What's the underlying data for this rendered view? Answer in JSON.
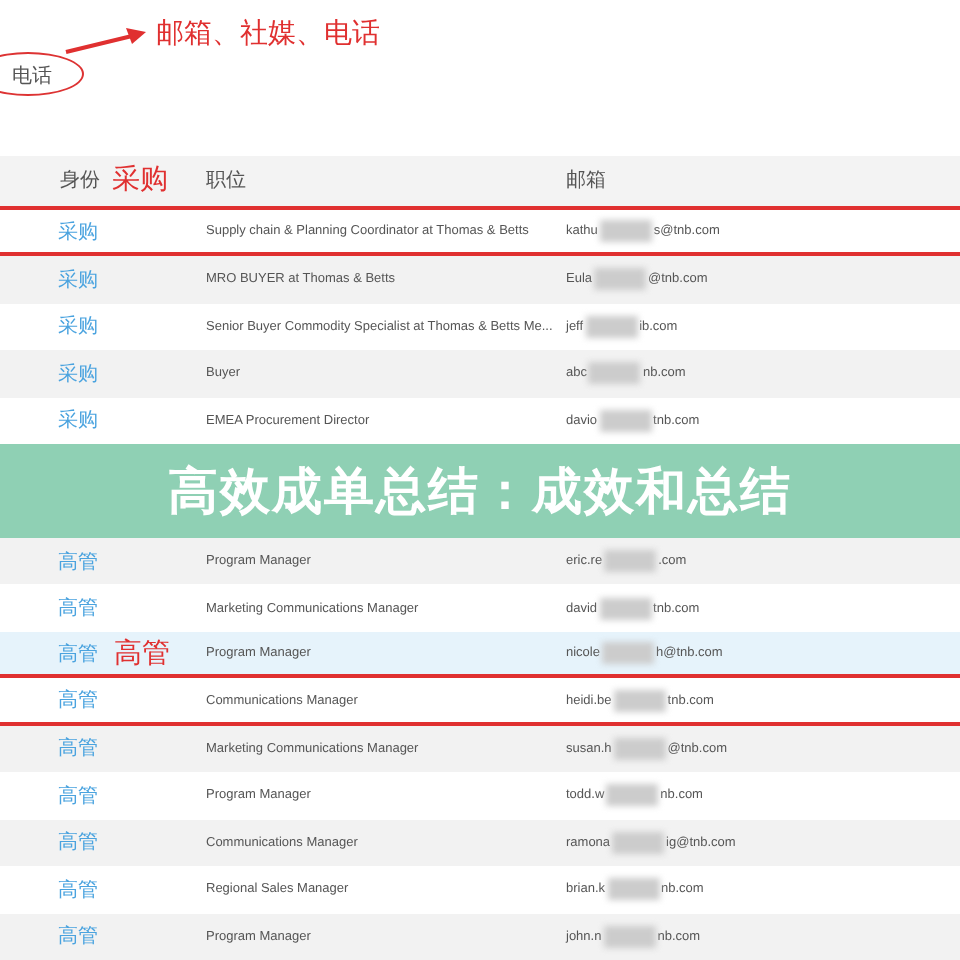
{
  "note": {
    "field": "电话",
    "annotation": "邮箱、社媒、电话"
  },
  "table": {
    "columns": [
      {
        "label": "身份",
        "annotation": "采购"
      },
      {
        "label": "职位"
      },
      {
        "label": "邮箱"
      }
    ],
    "rows": [
      {
        "kind": "row",
        "role": "采购",
        "position": "Supply chain & Planning Coordinator at Thomas & Betts",
        "email": {
          "start": "kathu",
          "end": "s@tnb.com"
        },
        "underlined": true,
        "selected": false
      },
      {
        "kind": "row",
        "role": "采购",
        "position": "MRO BUYER at Thomas & Betts",
        "email": {
          "start": "Eula",
          "end": "@tnb.com"
        },
        "underlined": false,
        "selected": false
      },
      {
        "kind": "row",
        "role": "采购",
        "position": "Senior Buyer Commodity Specialist at Thomas & Betts Me...",
        "email": {
          "start": "jeff",
          "end": "ib.com"
        },
        "underlined": false,
        "selected": false
      },
      {
        "kind": "row",
        "role": "采购",
        "position": "Buyer",
        "email": {
          "start": "abc",
          "end": "nb.com"
        },
        "underlined": false,
        "selected": false
      },
      {
        "kind": "row",
        "role": "采购",
        "position": "EMEA Procurement Director",
        "email": {
          "start": "davio",
          "end": "tnb.com"
        },
        "underlined": false,
        "selected": false
      },
      {
        "kind": "banner",
        "text": "高效成单总结：成效和总结"
      },
      {
        "kind": "row",
        "role": "高管",
        "position": "Program Manager",
        "email": {
          "start": "eric.re",
          "end": ".com"
        },
        "underlined": false,
        "selected": false
      },
      {
        "kind": "row",
        "role": "高管",
        "position": "Marketing Communications Manager",
        "email": {
          "start": "david",
          "end": "tnb.com"
        },
        "underlined": false,
        "selected": false
      },
      {
        "kind": "row",
        "role": "高管",
        "annotation": "高管",
        "position": "Program Manager",
        "email": {
          "start": "nicole",
          "end": "h@tnb.com"
        },
        "underlined": true,
        "selected": true
      },
      {
        "kind": "row",
        "role": "高管",
        "position": "Communications Manager",
        "email": {
          "start": "heidi.be",
          "end": "tnb.com"
        },
        "underlined": true,
        "selected": false
      },
      {
        "kind": "row",
        "role": "高管",
        "position": "Marketing Communications Manager",
        "email": {
          "start": "susan.h",
          "end": "@tnb.com"
        },
        "underlined": false,
        "selected": false
      },
      {
        "kind": "row",
        "role": "高管",
        "position": "Program Manager",
        "email": {
          "start": "todd.w",
          "end": "nb.com"
        },
        "underlined": false,
        "selected": false
      },
      {
        "kind": "row",
        "role": "高管",
        "position": "Communications Manager",
        "email": {
          "start": "ramona",
          "end": "ig@tnb.com"
        },
        "underlined": false,
        "selected": false
      },
      {
        "kind": "row",
        "role": "高管",
        "position": "Regional Sales Manager",
        "email": {
          "start": "brian.k",
          "end": "nb.com"
        },
        "underlined": false,
        "selected": false
      },
      {
        "kind": "row",
        "role": "高管",
        "position": "Program Manager",
        "email": {
          "start": "john.n",
          "end": "nb.com"
        },
        "underlined": false,
        "selected": false
      }
    ]
  }
}
